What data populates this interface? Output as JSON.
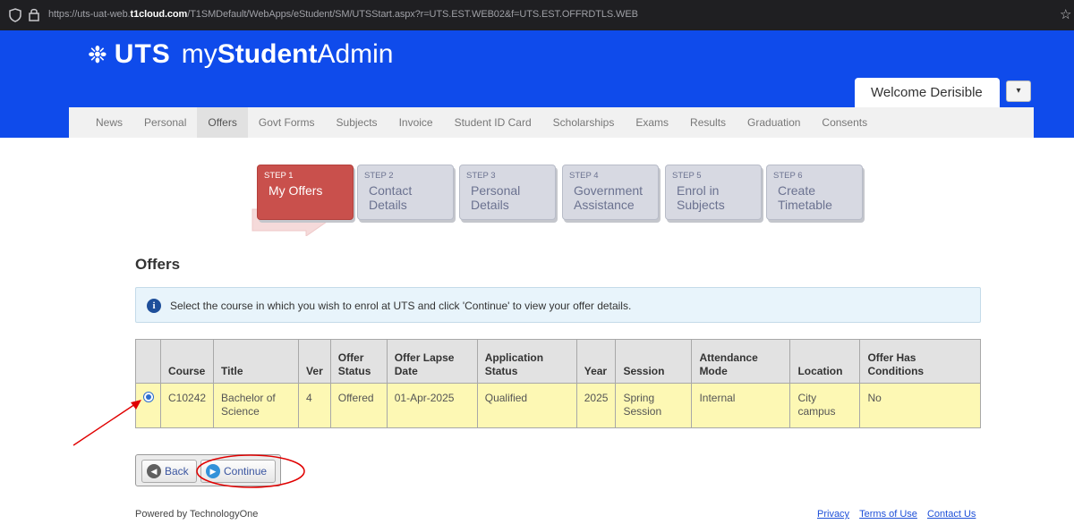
{
  "browser": {
    "url_prefix": "https://uts-uat-web.",
    "url_host": "t1cloud.com",
    "url_rest": "/T1SMDefault/WebApps/eStudent/SM/UTSStart.aspx?r=UTS.EST.WEB02&f=UTS.EST.OFFRDTLS.WEB"
  },
  "header": {
    "logo_uts": "UTS",
    "logo_my": "my",
    "logo_student": "Student",
    "logo_admin": "Admin",
    "welcome": "Welcome Derisible",
    "nav": [
      "News",
      "Personal",
      "Offers",
      "Govt Forms",
      "Subjects",
      "Invoice",
      "Student ID Card",
      "Scholarships",
      "Exams",
      "Results",
      "Graduation",
      "Consents"
    ],
    "active_nav": "Offers"
  },
  "steps": [
    {
      "num": "STEP 1",
      "label": "My Offers"
    },
    {
      "num": "STEP 2",
      "label": "Contact Details"
    },
    {
      "num": "STEP 3",
      "label": "Personal Details"
    },
    {
      "num": "STEP 4",
      "label": "Government Assistance"
    },
    {
      "num": "STEP 5",
      "label": "Enrol in Subjects"
    },
    {
      "num": "STEP 6",
      "label": "Create Timetable"
    }
  ],
  "page_title": "Offers",
  "info_message": "Select the course in which you wish to enrol at UTS and click 'Continue' to view your offer details.",
  "table": {
    "headers": [
      "",
      "Course",
      "Title",
      "Ver",
      "Offer Status",
      "Offer Lapse Date",
      "Application Status",
      "Year",
      "Session",
      "Attendance Mode",
      "Location",
      "Offer Has Conditions"
    ],
    "rows": [
      {
        "selected": true,
        "cells": [
          "C10242",
          "Bachelor of Science",
          "4",
          "Offered",
          "01-Apr-2025",
          "Qualified",
          "2025",
          "Spring Session",
          "Internal",
          "City campus",
          "No"
        ]
      }
    ]
  },
  "buttons": {
    "back": "Back",
    "continue": "Continue"
  },
  "footer": {
    "powered": "Powered by TechnologyOne",
    "privacy": "Privacy",
    "terms": "Terms of Use",
    "contact": "Contact Us"
  },
  "colors": {
    "header_blue": "#0f4beb",
    "active_step": "#c9504c",
    "row_highlight": "#fdf8b4",
    "annotation_red": "#e00000"
  }
}
